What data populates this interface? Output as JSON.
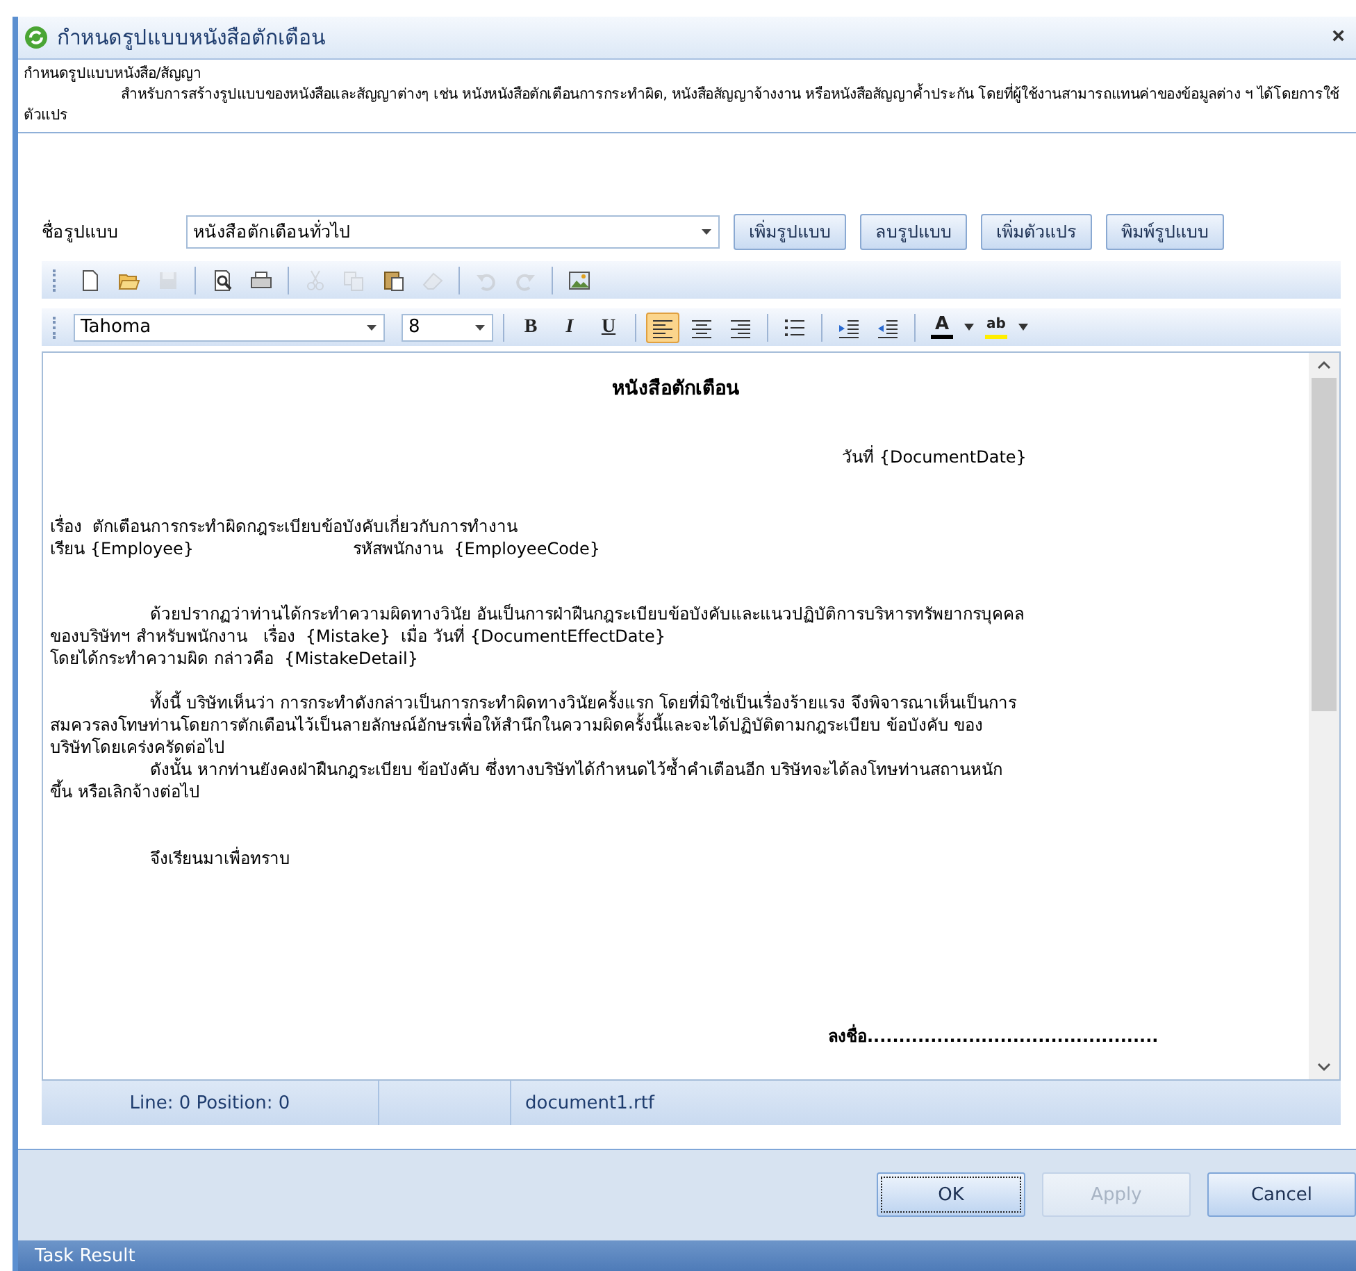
{
  "window": {
    "title": "กำหนดรูปแบบหนังสือตักเตือน",
    "close": "×"
  },
  "description": {
    "heading": "กำหนดรูปแบบหนังสือ/สัญญา",
    "text": "สำหรับการสร้างรูปแบบของหนังสือและสัญญาต่างๆ เช่น หนังหนังสือตักเตือนการกระทำผิด, หนังสือสัญญาจ้างงาน หรือหนังสือสัญญาค้ำประกัน โดยที่ผู้ใช้งานสามารถแทนค่าของข้อมูลต่าง ฯ ได้โดยการใช้ตัวแปร"
  },
  "template": {
    "label": "ชื่อรูปแบบ",
    "value": "หนังสือตักเตือนทั่วไป",
    "buttons": [
      "เพิ่มรูปแบบ",
      "ลบรูปแบบ",
      "เพิ่มตัวแปร",
      "พิมพ์รูปแบบ"
    ]
  },
  "toolbar": [
    {
      "kind": "new",
      "disabled": false
    },
    {
      "kind": "open",
      "disabled": false
    },
    {
      "kind": "save",
      "disabled": true
    },
    {
      "kind": "separator"
    },
    {
      "kind": "preview",
      "disabled": false
    },
    {
      "kind": "print",
      "disabled": false
    },
    {
      "kind": "separator"
    },
    {
      "kind": "cut",
      "disabled": true
    },
    {
      "kind": "copy",
      "disabled": true
    },
    {
      "kind": "paste",
      "disabled": false
    },
    {
      "kind": "eraser",
      "disabled": true
    },
    {
      "kind": "separator"
    },
    {
      "kind": "undo",
      "disabled": true
    },
    {
      "kind": "redo",
      "disabled": true
    },
    {
      "kind": "separator"
    },
    {
      "kind": "image",
      "disabled": false
    }
  ],
  "format_bar": {
    "font": "Tahoma",
    "size": "8",
    "buttons": [
      {
        "kind": "separator"
      },
      {
        "kind": "bold",
        "label": "B",
        "selected": false
      },
      {
        "kind": "italic",
        "label": "I",
        "selected": false
      },
      {
        "kind": "underline",
        "label": "U",
        "selected": false
      },
      {
        "kind": "separator"
      },
      {
        "kind": "align_left",
        "selected": true
      },
      {
        "kind": "align_center",
        "selected": false
      },
      {
        "kind": "align_right",
        "selected": false
      },
      {
        "kind": "separator"
      },
      {
        "kind": "bullets",
        "selected": false
      },
      {
        "kind": "separator"
      },
      {
        "kind": "indent",
        "selected": false
      },
      {
        "kind": "outdent",
        "selected": false
      },
      {
        "kind": "separator"
      },
      {
        "kind": "font_color",
        "label": "A",
        "selected": false
      },
      {
        "kind": "highlight",
        "label": "ab",
        "selected": false
      }
    ]
  },
  "document": [
    {
      "kind": "title",
      "lines": [
        {
          "text": "หนังสือตักเตือน",
          "indent": false
        }
      ]
    },
    {
      "kind": "date",
      "lines": [
        {
          "text": "วันที่ {DocumentDate}",
          "indent": false
        }
      ]
    },
    {
      "kind": "header",
      "lines": [
        {
          "text": "เรื่อง  ตักเตือนการกระทำผิดกฎระเบียบข้อบังคับเกี่ยวกับการทำงาน",
          "indent": false
        },
        {
          "text": "เรียน {Employee}",
          "tab_text": "รหัสพนักงาน  {EmployeeCode}",
          "indent": false
        }
      ]
    },
    {
      "kind": "body",
      "lines": [
        {
          "text": "ด้วยปรากฏว่าท่านได้กระทำความผิดทางวินัย อันเป็นการฝ่าฝืนกฎระเบียบข้อบังคับและแนวปฏิบัติการบริหารทรัพยากรบุคคล",
          "indent": true
        },
        {
          "text": "ของบริษัทฯ สำหรับพนักงาน   เรื่อง  {Mistake}  เมื่อ วันที่ {DocumentEffectDate}",
          "indent": false
        },
        {
          "text": "โดยได้กระทำความผิด กล่าวคือ  {MistakeDetail}",
          "indent": false
        }
      ]
    },
    {
      "kind": "body_continued",
      "lines": [
        {
          "text": "ทั้งนี้ บริษัทเห็นว่า การกระทำดังกล่าวเป็นการกระทำผิดทางวินัยครั้งแรก โดยที่มิใช่เป็นเรื่องร้ายแรง จึงพิจารณาเห็นเป็นการ",
          "indent": true
        },
        {
          "text": "สมควรลงโทษท่านโดยการตักเตือนไว้เป็นลายลักษณ์อักษรเพื่อให้สำนึกในความผิดครั้งนี้และจะได้ปฏิบัติตามกฎระเบียบ ข้อบังคับ ของ",
          "indent": false
        },
        {
          "text": "บริษัทโดยเคร่งครัดต่อไป",
          "indent": false
        },
        {
          "text": "ดังนั้น หากท่านยังคงฝ่าฝืนกฎระเบียบ ข้อบังคับ ซึ่งทางบริษัทได้กำหนดไว้ซ้ำคำเตือนอีก บริษัทจะได้ลงโทษท่านสถานหนัก",
          "indent": true
        },
        {
          "text": "ขึ้น หรือเลิกจ้างต่อไป",
          "indent": false
        }
      ]
    },
    {
      "kind": "closing",
      "lines": [
        {
          "text": "จึงเรียนมาเพื่อทราบ",
          "indent": true
        }
      ]
    },
    {
      "kind": "signature",
      "lines": [
        {
          "text": "ลงชื่อ..............................................",
          "indent": false
        }
      ]
    }
  ],
  "status_bar": {
    "position": "Line: 0  Position: 0",
    "file": "document1.rtf"
  },
  "buttons": [
    {
      "label": "OK",
      "disabled": false,
      "focused": true
    },
    {
      "label": "Apply",
      "disabled": true,
      "focused": false
    },
    {
      "label": "Cancel",
      "disabled": false,
      "focused": false
    }
  ],
  "task_panel": {
    "title": "Task Result"
  }
}
